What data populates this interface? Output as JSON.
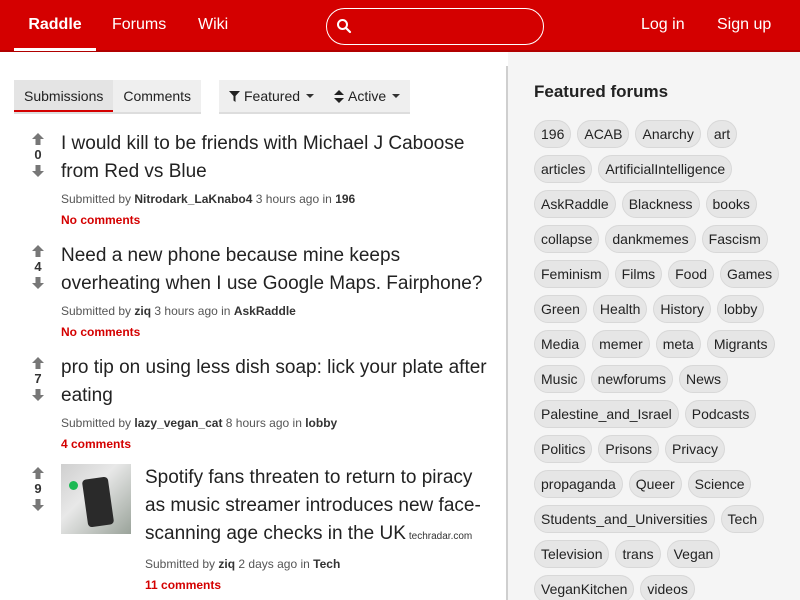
{
  "nav": {
    "brand": "Raddle",
    "forums": "Forums",
    "wiki": "Wiki",
    "login": "Log in",
    "signup": "Sign up",
    "search_placeholder": ""
  },
  "toolbar": {
    "tab_submissions": "Submissions",
    "tab_comments": "Comments",
    "featured": "Featured",
    "active": "Active"
  },
  "posts": [
    {
      "title": "I would kill to be friends with Michael J Caboose from Red vs Blue",
      "score": "0",
      "submitted_by": "Submitted by",
      "user": "Nitrodark_LaKnabo4",
      "time": "3 hours ago",
      "in": "in",
      "forum": "196",
      "comments": "No comments"
    },
    {
      "title": "Need a new phone because mine keeps overheating when I use Google Maps. Fairphone?",
      "score": "4",
      "submitted_by": "Submitted by",
      "user": "ziq",
      "time": "3 hours ago",
      "in": "in",
      "forum": "AskRaddle",
      "comments": "No comments"
    },
    {
      "title": "pro tip on using less dish soap: lick your plate after eating",
      "score": "7",
      "submitted_by": "Submitted by",
      "user": "lazy_vegan_cat",
      "time": "8 hours ago",
      "in": "in",
      "forum": "lobby",
      "comments": "4 comments"
    },
    {
      "title": "Spotify fans threaten to return to piracy as music streamer introduces new face-scanning age checks in the UK",
      "domain": "techradar.com",
      "score": "9",
      "submitted_by": "Submitted by",
      "user": "ziq",
      "time": "2 days ago",
      "in": "in",
      "forum": "Tech",
      "comments": "11 comments"
    }
  ],
  "sidebar": {
    "heading": "Featured forums",
    "forums": [
      "196",
      "ACAB",
      "Anarchy",
      "art",
      "articles",
      "ArtificialIntelligence",
      "AskRaddle",
      "Blackness",
      "books",
      "collapse",
      "dankmemes",
      "Fascism",
      "Feminism",
      "Films",
      "Food",
      "Games",
      "Green",
      "Health",
      "History",
      "lobby",
      "Media",
      "memer",
      "meta",
      "Migrants",
      "Music",
      "newforums",
      "News",
      "Palestine_and_Israel",
      "Podcasts",
      "Politics",
      "Prisons",
      "Privacy",
      "propaganda",
      "Queer",
      "Science",
      "Students_and_Universities",
      "Tech",
      "Television",
      "trans",
      "Vegan",
      "VeganKitchen",
      "videos"
    ]
  },
  "colors": {
    "brand": "#d40000",
    "sidebar_bg": "#f5f5f5"
  }
}
